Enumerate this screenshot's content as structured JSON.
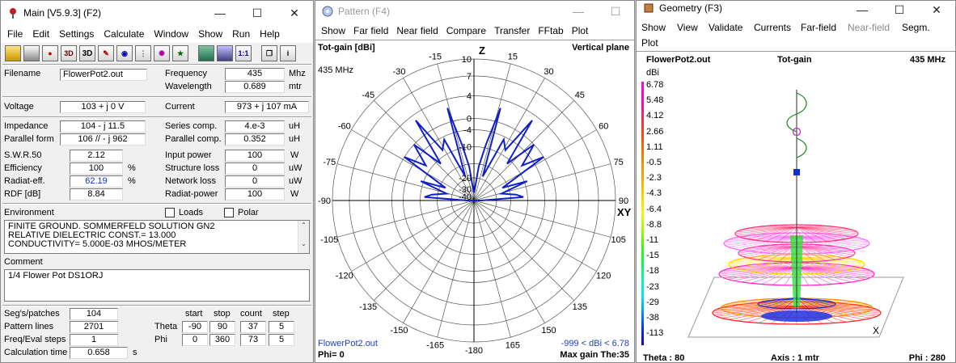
{
  "main": {
    "title": "Main [V5.9.3]  (F2)",
    "menu": [
      "File",
      "Edit",
      "Settings",
      "Calculate",
      "Window",
      "Show",
      "Run",
      "Help"
    ],
    "toolbar_icons": [
      "open-file-icon",
      "save-icon",
      "run-icon",
      "3d-view-icon",
      "edit-icon",
      "calculate-icon",
      "sweep-icon",
      "nec-icon",
      "geometry-icon",
      "calculator-icon",
      "grid-icon",
      "scale-icon",
      "copy-icon",
      "info-icon"
    ],
    "toolbar_text": {
      "three_d": "3D",
      "one_to_one": "1:1"
    },
    "filename_label": "Filename",
    "filename": "FlowerPot2.out",
    "frequency_label": "Frequency",
    "frequency": "435",
    "frequency_unit": "Mhz",
    "wavelength_label": "Wavelength",
    "wavelength": "0.689",
    "wavelength_unit": "mtr",
    "voltage_label": "Voltage",
    "voltage": "103 + j 0 V",
    "current_label": "Current",
    "current": "973 + j 107 mA",
    "impedance_label": "Impedance",
    "impedance": "104 - j 11.5",
    "series_comp_label": "Series comp.",
    "series_comp": "4.e-3",
    "series_comp_unit": "uH",
    "parallel_form_label": "Parallel form",
    "parallel_form": "106 // - j 962",
    "parallel_comp_label": "Parallel comp.",
    "parallel_comp": "0.352",
    "parallel_comp_unit": "uH",
    "swr_label": "S.W.R.50",
    "swr": "2.12",
    "input_power_label": "Input power",
    "input_power": "100",
    "input_power_unit": "W",
    "efficiency_label": "Efficiency",
    "efficiency": "100",
    "efficiency_unit": "%",
    "structure_loss_label": "Structure loss",
    "structure_loss": "0",
    "structure_loss_unit": "uW",
    "radiat_eff_label": "Radiat-eff.",
    "radiat_eff": "62.19",
    "radiat_eff_unit": "%",
    "network_loss_label": "Network loss",
    "network_loss": "0",
    "network_loss_unit": "uW",
    "rdf_label": "RDF [dB]",
    "rdf": "8.84",
    "radiat_power_label": "Radiat-power",
    "radiat_power": "100",
    "radiat_power_unit": "W",
    "environment_label": "Environment",
    "loads_label": "Loads",
    "polar_label": "Polar",
    "environment_lines": [
      "FINITE GROUND.  SOMMERFELD SOLUTION GN2",
      "RELATIVE DIELECTRIC CONST.= 13.000",
      "CONDUCTIVITY= 5.000E-03 MHOS/METER"
    ],
    "comment_label": "Comment",
    "comment": "1/4 Flower Pot DS1ORJ",
    "segs_label": "Seg's/patches",
    "segs": "104",
    "pattern_lines_label": "Pattern lines",
    "pattern_lines": "2701",
    "freq_steps_label": "Freq/Eval steps",
    "freq_steps": "1",
    "calc_time_label": "Calculation time",
    "calc_time": "0.658",
    "calc_time_unit": "s",
    "range_headers": {
      "start": "start",
      "stop": "stop",
      "count": "count",
      "step": "step"
    },
    "theta_label": "Theta",
    "theta": {
      "start": "-90",
      "stop": "90",
      "count": "37",
      "step": "5"
    },
    "phi_label": "Phi",
    "phi": {
      "start": "0",
      "stop": "360",
      "count": "73",
      "step": "5"
    }
  },
  "pattern": {
    "title": "Pattern   (F4)",
    "menu": [
      "Show",
      "Far field",
      "Near field",
      "Compare",
      "Transfer",
      "FFtab",
      "Plot"
    ],
    "tot_gain": "Tot-gain [dBi]",
    "frequency": "435 MHz",
    "plane": "Vertical plane",
    "z_label": "Z",
    "xy_label": "XY",
    "radial_labels": [
      "10",
      "7",
      "4",
      "0",
      "-4",
      "-10",
      "-20",
      "-30",
      "-40"
    ],
    "angle_labels": [
      "-15",
      "15",
      "-30",
      "30",
      "-45",
      "45",
      "-60",
      "60",
      "-75",
      "75",
      "-90",
      "90",
      "-105",
      "105",
      "-120",
      "120",
      "-135",
      "135",
      "-150",
      "150",
      "-165",
      "165",
      "-180"
    ],
    "filename": "FlowerPot2.out",
    "phi": "Phi= 0",
    "range": "-999 < dBi < 6.78",
    "max_gain": "Max gain The:35"
  },
  "geometry": {
    "title": "Geometry   (F3)",
    "menu": [
      "Show",
      "View",
      "Validate",
      "Currents",
      "Far-field",
      "Near-field",
      "Segm.",
      "Plot"
    ],
    "filename": "FlowerPot2.out",
    "tot_gain": "Tot-gain",
    "frequency": "435 MHz",
    "unit": "dBi",
    "scale": [
      "6.78",
      "5.48",
      "4.12",
      "2.66",
      "1.11",
      "-0.5",
      "-2.3",
      "-4.3",
      "-6.4",
      "-8.8",
      "-11",
      "-15",
      "-18",
      "-23",
      "-29",
      "-38",
      "-113"
    ],
    "scale_colors": [
      "#ff00ff",
      "#ff00c8",
      "#ff1e64",
      "#ff3c1e",
      "#ff6400",
      "#ff8c00",
      "#ffaa00",
      "#ffd200",
      "#e6ff00",
      "#96ff00",
      "#32ff00",
      "#00ff3c",
      "#00ffa0",
      "#00e6ff",
      "#0096ff",
      "#0032ff",
      "#1e00c8"
    ],
    "theta": "Theta : 80",
    "axis": "Axis : 1 mtr",
    "phi": "Phi : 280",
    "x_marker": "X"
  }
}
